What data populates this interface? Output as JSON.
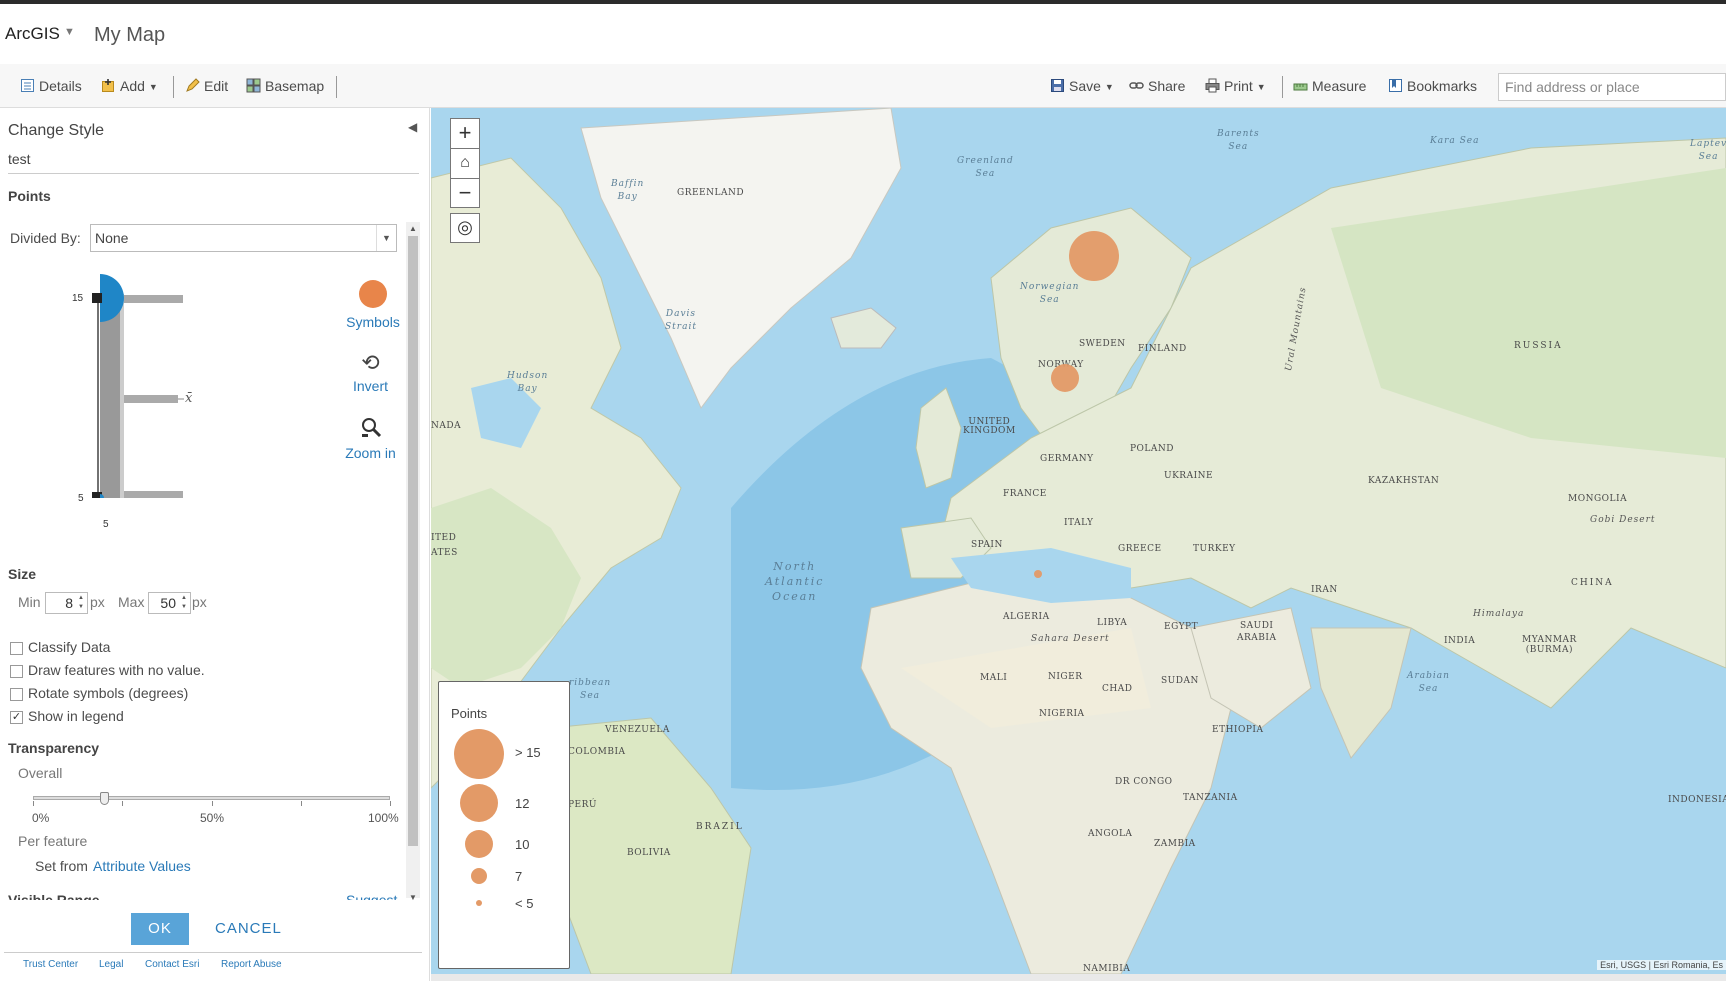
{
  "app": {
    "name": "ArcGIS",
    "map_title": "My Map"
  },
  "toolbar": {
    "details": "Details",
    "add": "Add",
    "edit": "Edit",
    "basemap": "Basemap",
    "save": "Save",
    "share": "Share",
    "print": "Print",
    "measure": "Measure",
    "bookmarks": "Bookmarks"
  },
  "search": {
    "placeholder": "Find address or place"
  },
  "panel": {
    "title": "Change Style",
    "layer_name": "test",
    "points_header": "Points",
    "divided_by_label": "Divided By:",
    "divided_by_value": "None",
    "histogram": {
      "top_value": "15",
      "bottom_value": "5",
      "bottom_axis_value": "5",
      "mean_symbol": "x̄"
    },
    "symbols_label": "Symbols",
    "invert_label": "Invert",
    "zoom_in_label": "Zoom in",
    "size_header": "Size",
    "min_label": "Min",
    "min_value": "8",
    "max_label": "Max",
    "max_value": "50",
    "px_unit": "px",
    "options": [
      {
        "label": "Classify Data",
        "checked": false
      },
      {
        "label": "Draw features with no value.",
        "checked": false
      },
      {
        "label": "Rotate symbols (degrees)",
        "checked": false
      },
      {
        "label": "Show in legend",
        "checked": true
      }
    ],
    "transparency_header": "Transparency",
    "overall_label": "Overall",
    "transparency_value_percent": 20,
    "slider_ticks": [
      "0%",
      "50%",
      "100%"
    ],
    "per_feature_label": "Per feature",
    "set_from_label": "Set from",
    "attribute_values_link": "Attribute Values",
    "visible_range_header": "Visible Range",
    "suggest_link": "Suggest",
    "ok_label": "OK",
    "cancel_label": "CANCEL",
    "footer_links": [
      "Trust Center",
      "Legal",
      "Contact Esri",
      "Report Abuse"
    ]
  },
  "map": {
    "labels": {
      "greenland": "GREENLAND",
      "sweden": "SWEDEN",
      "finland": "FINLAND",
      "norway": "NORWAY",
      "russia": "RUSSIA",
      "uk": "UNITED\nKINGDOM",
      "poland": "POLAND",
      "germany": "GERMANY",
      "ukraine": "UKRAINE",
      "kazakhstan": "KAZAKHSTAN",
      "france": "FRANCE",
      "mongolia": "MONGOLIA",
      "italy": "ITALY",
      "spain": "SPAIN",
      "greece": "GREECE",
      "turkey": "TURKEY",
      "china": "CHINA",
      "iran": "IRAN",
      "algeria": "ALGERIA",
      "libya": "LIBYA",
      "egypt": "EGYPT",
      "saudi": "SAUDI\nARABIA",
      "india": "INDIA",
      "myanmar": "MYANMAR\n(BURMA)",
      "mali": "MALI",
      "niger": "NIGER",
      "chad": "CHAD",
      "sudan": "SUDAN",
      "nigeria": "NIGERIA",
      "ethiopia": "ETHIOPIA",
      "drc": "DR CONGO",
      "tanzania": "TANZANIA",
      "angola": "ANGOLA",
      "zambia": "ZAMBIA",
      "namibia": "NAMIBIA",
      "venezuela": "VENEZUELA",
      "colombia": "COLOMBIA",
      "peru": "PERÚ",
      "brazil": "BRAZIL",
      "bolivia": "BOLIVIA",
      "indonesia": "INDONESIA",
      "canada": "NADA",
      "us": "ITED\nATES"
    },
    "seas": {
      "barents": "Barents\nSea",
      "kara": "Kara Sea",
      "laptev": "Laptev\nSea",
      "greenland_sea": "Greenland\nSea",
      "baffin": "Baffin\nBay",
      "davis": "Davis\nStrait",
      "norwegian": "Norwegian\nSea",
      "hudson": "Hudson\nBay",
      "atlantic": "North\nAtlantic\nOcean",
      "caribbean": "ribbean\nSea",
      "arabian": "Arabian\nSea",
      "sahara": "Sahara Desert",
      "gobi": "Gobi Desert",
      "himalaya": "Himalaya",
      "ural": "Ural Mountains"
    },
    "attribution": "Esri, USGS | Esri Romania, Es",
    "legend": {
      "title": "Points",
      "items": [
        ">  15",
        "12",
        "10",
        "7",
        "<  5"
      ]
    }
  },
  "colors": {
    "accent": "#59a4d8",
    "link": "#2a7ab8",
    "symbol": "#e39a67",
    "histogram_handle": "#1f86c7"
  }
}
